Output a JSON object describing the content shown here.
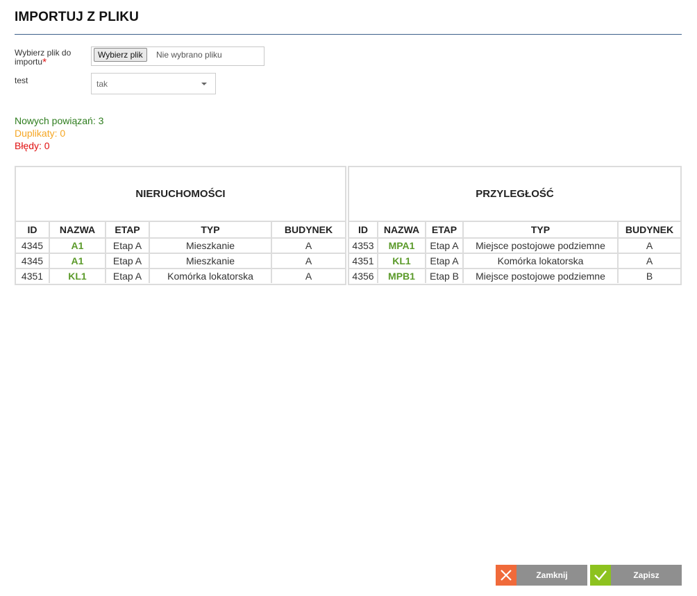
{
  "dialog": {
    "title": "IMPORTUJ Z PLIKU"
  },
  "form": {
    "file_label": "Wybierz plik do importu",
    "file_required": "*",
    "file_button": "Wybierz plik",
    "file_status": "Nie wybrano pliku",
    "test_label": "test",
    "test_value": "tak"
  },
  "stats": {
    "new": "Nowych powiązań: 3",
    "duplicates": "Duplikaty: 0",
    "errors": "Błędy: 0"
  },
  "colors": {
    "new": "#2e7d1e",
    "duplicates": "#f5a623",
    "errors": "#e01010",
    "name_link": "#5b9a2a",
    "close_accent": "#f06a3a",
    "save_accent": "#8dc21f"
  },
  "left_table": {
    "title": "NIERUCHOMOŚCI",
    "columns": [
      "ID",
      "NAZWA",
      "ETAP",
      "TYP",
      "BUDYNEK"
    ],
    "rows": [
      [
        "4345",
        "A1",
        "Etap A",
        "Mieszkanie",
        "A"
      ],
      [
        "4345",
        "A1",
        "Etap A",
        "Mieszkanie",
        "A"
      ],
      [
        "4351",
        "KL1",
        "Etap A",
        "Komórka lokatorska",
        "A"
      ]
    ]
  },
  "right_table": {
    "title": "PRZYLEGŁOŚĆ",
    "columns": [
      "ID",
      "NAZWA",
      "ETAP",
      "TYP",
      "BUDYNEK"
    ],
    "rows": [
      [
        "4353",
        "MPA1",
        "Etap A",
        "Miejsce postojowe podziemne",
        "A"
      ],
      [
        "4351",
        "KL1",
        "Etap A",
        "Komórka lokatorska",
        "A"
      ],
      [
        "4356",
        "MPB1",
        "Etap B",
        "Miejsce postojowe podziemne",
        "B"
      ]
    ]
  },
  "buttons": {
    "close": {
      "label": "Zamknij",
      "icon": "close-icon"
    },
    "save": {
      "label": "Zapisz",
      "icon": "check-icon"
    }
  }
}
